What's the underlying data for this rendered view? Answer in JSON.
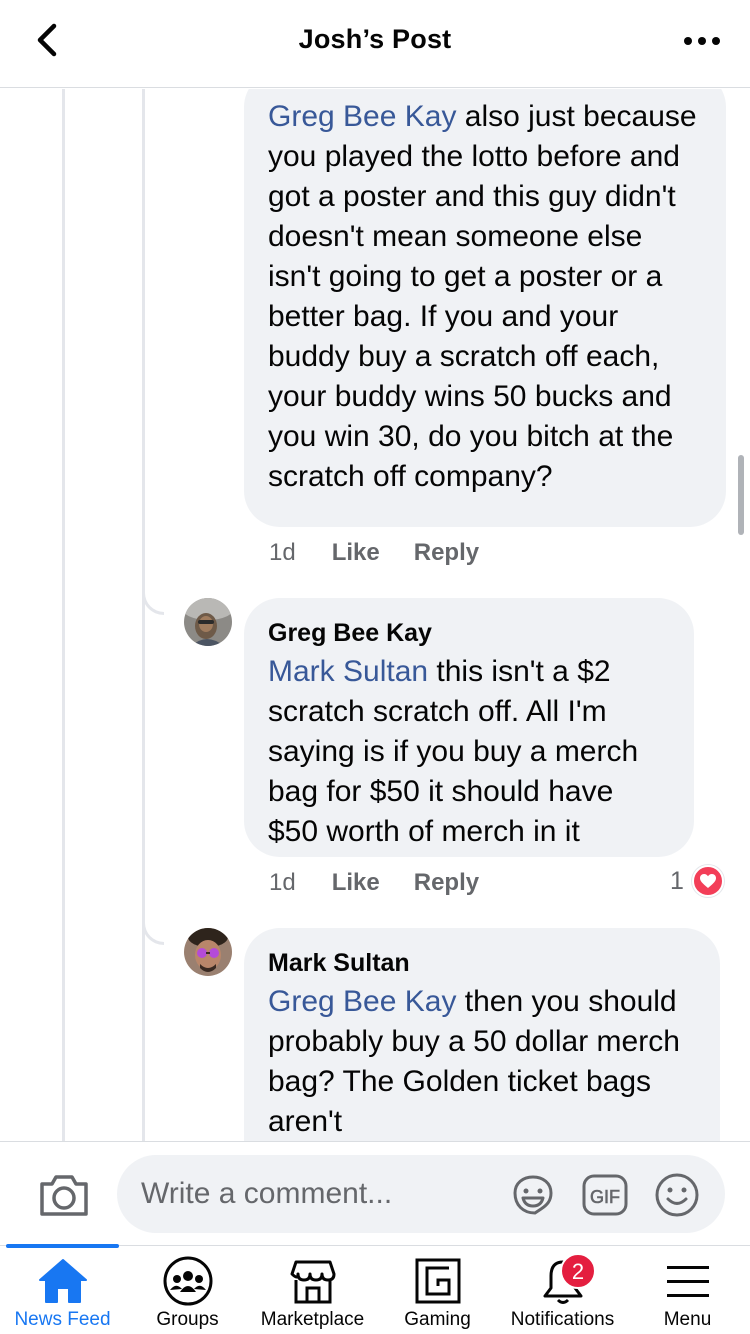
{
  "header": {
    "title": "Josh’s Post"
  },
  "comments": [
    {
      "mention": "Greg Bee Kay",
      "text": " also just because you played the lotto before and got a poster and this guy didn't doesn't mean someone else isn't going to get a poster or a better bag. If you and your buddy buy a scratch off each, your buddy wins 50 bucks and you win 30, do you bitch at the scratch off company?",
      "time": "1d",
      "like_label": "Like",
      "reply_label": "Reply"
    },
    {
      "author": "Greg Bee Kay",
      "mention": "Mark Sultan",
      "text": " this isn't a $2 scratch scratch off. All I'm saying is if you buy a merch bag for $50 it should have $50 worth of merch in it",
      "time": "1d",
      "like_label": "Like",
      "reply_label": "Reply",
      "reaction_count": "1",
      "reaction_icon": "heart-icon"
    },
    {
      "author": "Mark Sultan",
      "mention": "Greg Bee Kay",
      "text": " then you should probably buy a 50 dollar merch bag? The Golden ticket bags aren't"
    }
  ],
  "composer": {
    "placeholder": "Write a comment...",
    "icons": [
      "camera-icon",
      "sticker-icon",
      "gif-icon",
      "emoji-icon"
    ],
    "gif_label": "GIF"
  },
  "tabbar": {
    "items": [
      {
        "label": "News Feed",
        "icon": "home-icon",
        "active": true
      },
      {
        "label": "Groups",
        "icon": "groups-icon"
      },
      {
        "label": "Marketplace",
        "icon": "marketplace-icon"
      },
      {
        "label": "Gaming",
        "icon": "gaming-icon"
      },
      {
        "label": "Notifications",
        "icon": "bell-icon",
        "badge": "2"
      },
      {
        "label": "Menu",
        "icon": "menu-icon"
      }
    ]
  },
  "colors": {
    "accent": "#1877f2",
    "mention": "#385898",
    "bubble": "#f0f2f5",
    "badge": "#e41e3f",
    "heart": "#f33e58"
  }
}
